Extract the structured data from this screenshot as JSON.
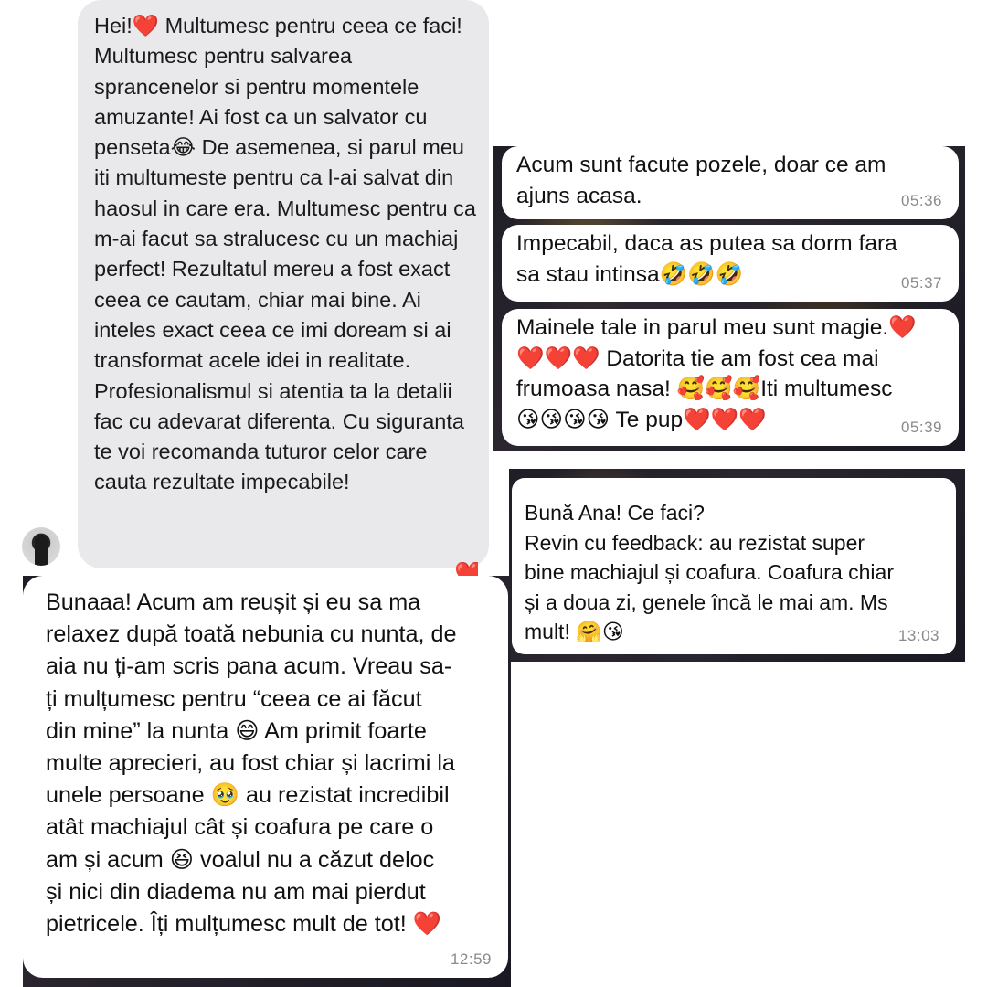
{
  "msg_grey": {
    "text": "Hei!❤️ Multumesc pentru ceea ce\nfaci! Multumesc pentru salvarea\nsprancenelor si pentru momentele\namuzante! Ai fost ca un salvator cu\npenseta😂 De asemenea, si parul\nmeu iti multumeste  pentru ca l-ai\nsalvat din haosul in care era.\nMultumesc pentru ca m-ai facut sa\nstralucesc cu un machiaj perfect!\nRezultatul mereu a fost exact ceea\nce cautam, chiar mai bine.\nAi inteles exact ceea ce imi doream\nsi ai transformat acele idei in\nrealitate. Profesionalismul si atentia\nta la detalii fac cu adevarat\ndiferenta. Cu siguranta te voi\nrecomanda tuturor celor care cauta\nrezultate impecabile!",
    "reaction": "❤️"
  },
  "msg_pozele": {
    "text": "Acum sunt facute pozele, doar ce am\najuns acasa.",
    "time": "05:36"
  },
  "msg_impecabil": {
    "text": "Impecabil, daca as putea sa dorm fara\nsa stau intinsa🤣🤣🤣",
    "time": "05:37"
  },
  "msg_mainele": {
    "text": "Mainele tale in parul meu sunt magie.❤️\n❤️❤️❤️ Datorita tie am fost cea mai\nfrumoasa nasa! 🥰🥰🥰Iti multumesc\n😘😘😘😘 Te pup❤️❤️❤️",
    "time": "05:39"
  },
  "msg_ana": {
    "text": "Bună Ana! Ce faci?\nRevin cu feedback: au rezistat super\nbine machiajul și coafura. Coafura chiar\nși a doua zi, genele încă le mai am. Ms\nmult! 🤗😘",
    "time": "13:03"
  },
  "msg_bunaaa": {
    "text": "Bunaaa! Acum am reușit și eu sa ma\nrelaxez după toată nebunia cu nunta, de\naia nu ți-am scris pana acum. Vreau sa-\nți mulțumesc pentru “ceea ce ai făcut\ndin mine” la nunta 😄 Am primit foarte\nmulte aprecieri, au fost chiar și lacrimi la\nunele persoane 🥹 au rezistat incredibil\natât machiajul cât și coafura pe care o\nam și acum 😆 voalul nu a căzut deloc\nși nici din diadema nu am mai pierdut\npietricele. Îți mulțumesc mult de tot! ❤️",
    "time": "12:59"
  },
  "colors": {
    "grey_bubble": "#e9e9eb",
    "bubble": "#ffffff",
    "time_text": "#8a8a8a",
    "heart": "#e0242b"
  }
}
